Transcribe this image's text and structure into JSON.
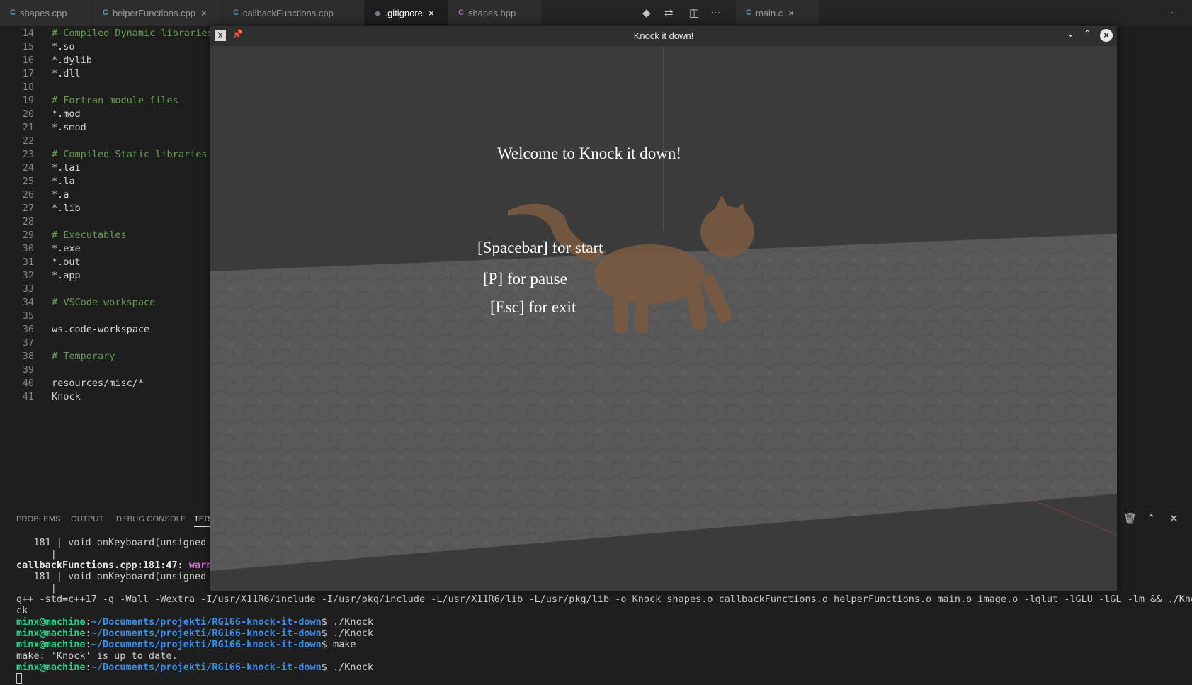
{
  "tabs": [
    {
      "icon": "C",
      "label": "shapes.cpp",
      "active": false
    },
    {
      "icon": "C",
      "label": "helperFunctions.cpp",
      "close": "×",
      "active": false
    },
    {
      "icon": "C",
      "label": "callbackFunctions.cpp",
      "active": false
    },
    {
      "icon": "◆",
      "label": ".gitignore",
      "close": "×",
      "active": true
    },
    {
      "icon": "C",
      "label": "shapes.hpp",
      "active": false
    },
    {
      "icon": "C",
      "label": "main.c",
      "close": "×",
      "active": false
    }
  ],
  "toolbar": {
    "more": "···",
    "more2": "···"
  },
  "editor_lines": [
    {
      "n": "14",
      "t": "# Compiled Dynamic libraries",
      "c": true
    },
    {
      "n": "15",
      "t": "*.so",
      "c": false
    },
    {
      "n": "16",
      "t": "*.dylib",
      "c": false
    },
    {
      "n": "17",
      "t": "*.dll",
      "c": false
    },
    {
      "n": "18",
      "t": "",
      "c": false
    },
    {
      "n": "19",
      "t": "# Fortran module files",
      "c": true
    },
    {
      "n": "20",
      "t": "*.mod",
      "c": false
    },
    {
      "n": "21",
      "t": "*.smod",
      "c": false
    },
    {
      "n": "22",
      "t": "",
      "c": false
    },
    {
      "n": "23",
      "t": "# Compiled Static libraries",
      "c": true
    },
    {
      "n": "24",
      "t": "*.lai",
      "c": false
    },
    {
      "n": "25",
      "t": "*.la",
      "c": false
    },
    {
      "n": "26",
      "t": "*.a",
      "c": false
    },
    {
      "n": "27",
      "t": "*.lib",
      "c": false
    },
    {
      "n": "28",
      "t": "",
      "c": false
    },
    {
      "n": "29",
      "t": "# Executables",
      "c": true
    },
    {
      "n": "30",
      "t": "*.exe",
      "c": false
    },
    {
      "n": "31",
      "t": "*.out",
      "c": false
    },
    {
      "n": "32",
      "t": "*.app",
      "c": false
    },
    {
      "n": "33",
      "t": "",
      "c": false
    },
    {
      "n": "34",
      "t": "# VSCode workspace",
      "c": true
    },
    {
      "n": "35",
      "t": "",
      "c": false
    },
    {
      "n": "36",
      "t": "ws.code-workspace",
      "c": false
    },
    {
      "n": "37",
      "t": "",
      "c": false
    },
    {
      "n": "38",
      "t": "# Temporary",
      "c": true
    },
    {
      "n": "39",
      "t": "",
      "c": false
    },
    {
      "n": "40",
      "t": "resources/misc/*",
      "c": false
    },
    {
      "n": "41",
      "t": "Knock",
      "c": false
    }
  ],
  "panel": {
    "tabs": [
      "PROBLEMS",
      "OUTPUT",
      "DEBUG CONSOLE",
      "TERM"
    ],
    "terminal": {
      "l1_num": "181 |",
      "l1_code": " void onKeyboard(unsigned c",
      "l2_bar": "|",
      "l3_file": "callbackFunctions.cpp:181:47:",
      "l3_warn": " warn",
      "l4_num": "181 |",
      "l4_code": " void onKeyboard(unsigned c",
      "l5_bar": "|",
      "l6": "g++ -std=c++17 -g -Wall -Wextra -I/usr/X11R6/include -I/usr/pkg/include -L/usr/X11R6/lib -L/usr/pkg/lib -o Knock shapes.o callbackFunctions.o helperFunctions.o main.o image.o -lglut -lGLU -lGL -lm && ./Kno",
      "l7": "ck",
      "user": "minx@machine",
      "path": "~/Documents/projekti/RG166-knock-it-down",
      "cmd1": "$ ./Knock",
      "cmd2": "$ ./Knock",
      "cmd3": "$ make",
      "make_out": "make: 'Knock' is up to date.",
      "cmd4": "$ ./Knock"
    }
  },
  "glwindow": {
    "title": "Knock it down!",
    "welcome": "Welcome to Knock it down!",
    "start": "[Spacebar] for start",
    "pause": "[P] for pause",
    "exit": "[Esc] for exit",
    "colors": {
      "sky": "#3b3b3b",
      "floor": "#5a5a5a",
      "cat": "#7a5a40"
    }
  }
}
